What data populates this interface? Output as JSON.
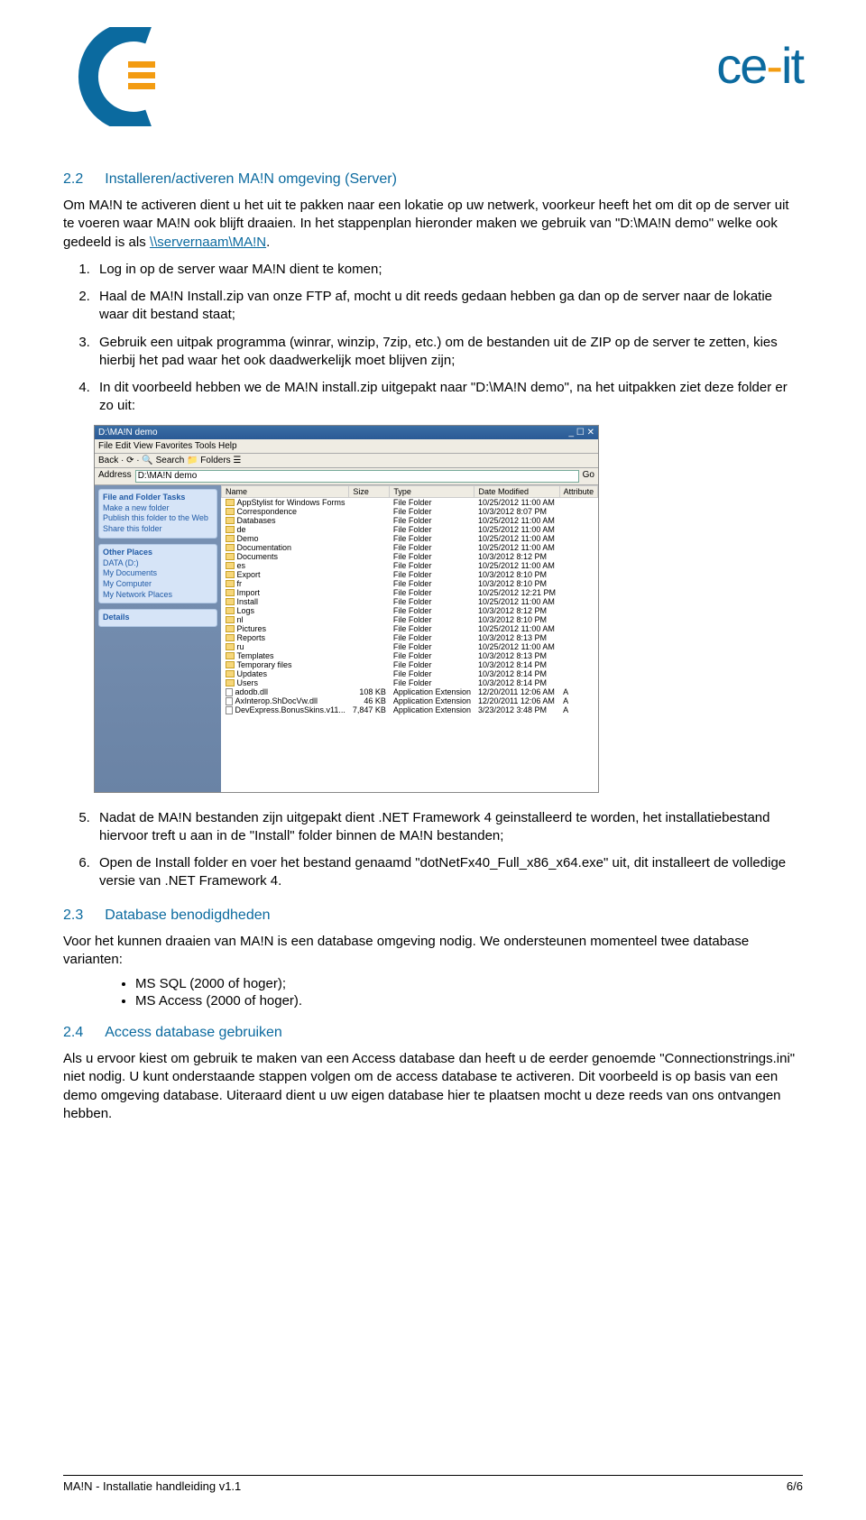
{
  "header": {
    "brand_ce": "ce",
    "brand_dash": "-",
    "brand_it": "it"
  },
  "s22": {
    "num": "2.2",
    "title": "Installeren/activeren MA!N omgeving (Server)",
    "p1a": "Om MA!N te activeren dient u het uit te pakken naar een lokatie op uw netwerk, voorkeur heeft het om dit op de server uit te voeren waar MA!N ook blijft draaien. In het stappenplan hieronder maken we gebruik van \"D:\\MA!N demo\" welke ook gedeeld is als ",
    "link": "\\\\servernaam\\MA!N",
    "p1b": ".",
    "li1": "Log in op de server waar MA!N dient te komen;",
    "li2": "Haal de MA!N Install.zip van onze FTP af, mocht u dit reeds gedaan hebben ga dan op de server naar de lokatie waar dit bestand staat;",
    "li3": "Gebruik een uitpak programma (winrar, winzip, 7zip, etc.) om de bestanden uit de ZIP op de server te zetten, kies hierbij het pad waar het ook daadwerkelijk moet blijven zijn;",
    "li4": "In dit voorbeeld hebben we de MA!N install.zip uitgepakt naar \"D:\\MA!N demo\", na het uitpakken ziet deze folder er zo uit:",
    "li5": "Nadat de MA!N bestanden zijn uitgepakt dient .NET Framework 4 geinstalleerd te worden, het installatiebestand hiervoor treft u aan in de \"Install\" folder binnen de MA!N bestanden;",
    "li6": "Open de Install folder en voer het bestand genaamd \"dotNetFx40_Full_x86_x64.exe\" uit, dit installeert de volledige versie van .NET Framework 4."
  },
  "s23": {
    "num": "2.3",
    "title": "Database benodigdheden",
    "p1": "Voor het kunnen draaien van MA!N is een database omgeving nodig. We ondersteunen momenteel twee database varianten:",
    "b1": "MS SQL (2000 of hoger);",
    "b2": "MS Access (2000 of hoger)."
  },
  "s24": {
    "num": "2.4",
    "title": "Access database gebruiken",
    "p1": "Als u ervoor kiest om gebruik te maken van een Access database dan heeft u de eerder genoemde \"Connectionstrings.ini\" niet nodig. U kunt onderstaande stappen volgen om de access database te activeren. Dit voorbeeld is op basis van een demo omgeving database. Uiteraard dient u uw eigen database hier te plaatsen mocht u deze reeds van ons ontvangen hebben."
  },
  "screenshot": {
    "title": "D:\\MA!N demo",
    "menu": "File   Edit   View   Favorites   Tools   Help",
    "toolbar": "Back  ·  ⟳  ·  🔍 Search   📁 Folders   ☰",
    "addr_label": "Address",
    "addr_value": "D:\\MA!N demo",
    "go": "Go",
    "side": {
      "p1_title": "File and Folder Tasks",
      "p1_items": [
        "Make a new folder",
        "Publish this folder to the Web",
        "Share this folder"
      ],
      "p2_title": "Other Places",
      "p2_items": [
        "DATA (D:)",
        "My Documents",
        "My Computer",
        "My Network Places"
      ],
      "p3_title": "Details"
    },
    "cols": [
      "Name",
      "Size",
      "Type",
      "Date Modified",
      "Attribute"
    ],
    "rows": [
      {
        "n": "AppStylist for Windows Forms",
        "s": "",
        "t": "File Folder",
        "d": "10/25/2012 11:00 AM",
        "a": ""
      },
      {
        "n": "Correspondence",
        "s": "",
        "t": "File Folder",
        "d": "10/3/2012 8:07 PM",
        "a": ""
      },
      {
        "n": "Databases",
        "s": "",
        "t": "File Folder",
        "d": "10/25/2012 11:00 AM",
        "a": ""
      },
      {
        "n": "de",
        "s": "",
        "t": "File Folder",
        "d": "10/25/2012 11:00 AM",
        "a": ""
      },
      {
        "n": "Demo",
        "s": "",
        "t": "File Folder",
        "d": "10/25/2012 11:00 AM",
        "a": ""
      },
      {
        "n": "Documentation",
        "s": "",
        "t": "File Folder",
        "d": "10/25/2012 11:00 AM",
        "a": ""
      },
      {
        "n": "Documents",
        "s": "",
        "t": "File Folder",
        "d": "10/3/2012 8:12 PM",
        "a": ""
      },
      {
        "n": "es",
        "s": "",
        "t": "File Folder",
        "d": "10/25/2012 11:00 AM",
        "a": ""
      },
      {
        "n": "Export",
        "s": "",
        "t": "File Folder",
        "d": "10/3/2012 8:10 PM",
        "a": ""
      },
      {
        "n": "fr",
        "s": "",
        "t": "File Folder",
        "d": "10/3/2012 8:10 PM",
        "a": ""
      },
      {
        "n": "Import",
        "s": "",
        "t": "File Folder",
        "d": "10/25/2012 12:21 PM",
        "a": ""
      },
      {
        "n": "Install",
        "s": "",
        "t": "File Folder",
        "d": "10/25/2012 11:00 AM",
        "a": ""
      },
      {
        "n": "Logs",
        "s": "",
        "t": "File Folder",
        "d": "10/3/2012 8:12 PM",
        "a": ""
      },
      {
        "n": "nl",
        "s": "",
        "t": "File Folder",
        "d": "10/3/2012 8:10 PM",
        "a": ""
      },
      {
        "n": "Pictures",
        "s": "",
        "t": "File Folder",
        "d": "10/25/2012 11:00 AM",
        "a": ""
      },
      {
        "n": "Reports",
        "s": "",
        "t": "File Folder",
        "d": "10/3/2012 8:13 PM",
        "a": ""
      },
      {
        "n": "ru",
        "s": "",
        "t": "File Folder",
        "d": "10/25/2012 11:00 AM",
        "a": ""
      },
      {
        "n": "Templates",
        "s": "",
        "t": "File Folder",
        "d": "10/3/2012 8:13 PM",
        "a": ""
      },
      {
        "n": "Temporary files",
        "s": "",
        "t": "File Folder",
        "d": "10/3/2012 8:14 PM",
        "a": ""
      },
      {
        "n": "Updates",
        "s": "",
        "t": "File Folder",
        "d": "10/3/2012 8:14 PM",
        "a": ""
      },
      {
        "n": "Users",
        "s": "",
        "t": "File Folder",
        "d": "10/3/2012 8:14 PM",
        "a": ""
      },
      {
        "n": "adodb.dll",
        "s": "108 KB",
        "t": "Application Extension",
        "d": "12/20/2011 12:06 AM",
        "a": "A"
      },
      {
        "n": "AxInterop.ShDocVw.dll",
        "s": "46 KB",
        "t": "Application Extension",
        "d": "12/20/2011 12:06 AM",
        "a": "A"
      },
      {
        "n": "DevExpress.BonusSkins.v11...",
        "s": "7,847 KB",
        "t": "Application Extension",
        "d": "3/23/2012 3:48 PM",
        "a": "A"
      }
    ]
  },
  "footer": {
    "left": "MA!N - Installatie handleiding v1.1",
    "right": "6/6"
  }
}
